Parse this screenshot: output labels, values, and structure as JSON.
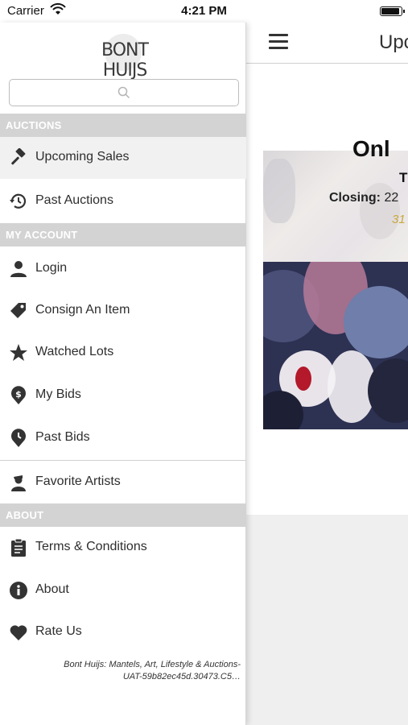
{
  "status_bar": {
    "carrier": "Carrier",
    "time": "4:21 PM"
  },
  "sidebar": {
    "logo_text": "BONT HUIJS",
    "search": {
      "placeholder": ""
    },
    "sections": {
      "auctions": "AUCTIONS",
      "my_account": "MY ACCOUNT",
      "about": "ABOUT"
    },
    "items": [
      {
        "label": "Upcoming Sales",
        "icon": "gavel-icon",
        "active": true
      },
      {
        "label": "Past Auctions",
        "icon": "history-icon"
      },
      {
        "label": "Login",
        "icon": "user-icon"
      },
      {
        "label": "Consign An Item",
        "icon": "tag-icon"
      },
      {
        "label": "Watched Lots",
        "icon": "star-icon"
      },
      {
        "label": "My Bids",
        "icon": "dollar-pin-icon"
      },
      {
        "label": "Past Bids",
        "icon": "clock-pin-icon"
      },
      {
        "label": "Favorite Artists",
        "icon": "artist-icon"
      },
      {
        "label": "Terms & Conditions",
        "icon": "clipboard-icon"
      },
      {
        "label": "About",
        "icon": "info-icon"
      },
      {
        "label": "Rate Us",
        "icon": "heart-icon"
      }
    ],
    "footer_line1": "Bont Huijs: Mantels, Art, Lifestyle & Auctions-",
    "footer_line2": "UAT-59b82ec45d.30473.C5…"
  },
  "main": {
    "title_partial": "Upc",
    "card": {
      "title_partial": "Onl",
      "line_partial": "T",
      "closing_label": "Closing:",
      "closing_value_partial": "22",
      "date_partial": "31"
    }
  },
  "colors": {
    "section_bg": "#d3d3d3",
    "active_item_bg": "#f1f1f1",
    "date_gold": "#c9a83c"
  }
}
